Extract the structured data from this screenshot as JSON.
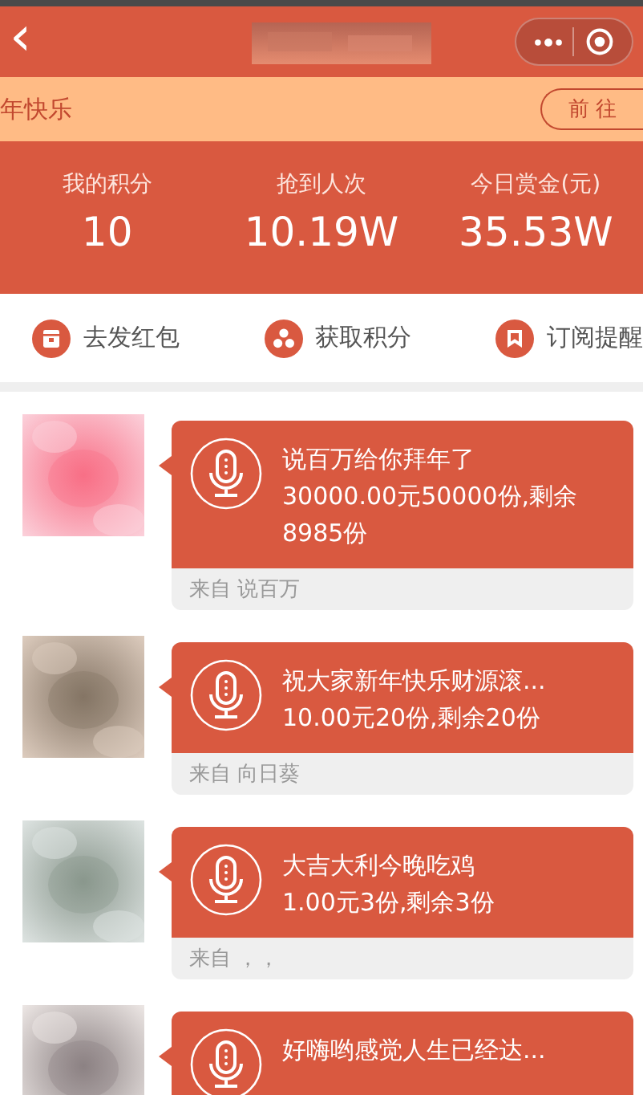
{
  "nav": {
    "back": "‹"
  },
  "banner": {
    "text": "年快乐",
    "button": "前 往"
  },
  "stats": [
    {
      "label": "我的积分",
      "value": "10"
    },
    {
      "label": "抢到人次",
      "value": "10.19W"
    },
    {
      "label": "今日赏金(元)",
      "value": "35.53W"
    }
  ],
  "actions": [
    {
      "kind": "send",
      "label": "去发红包"
    },
    {
      "kind": "points",
      "label": "获取积分"
    },
    {
      "kind": "subscribe",
      "label": "订阅提醒"
    }
  ],
  "posts": [
    {
      "title": "说百万给你拜年了",
      "detail": "30000.00元50000份,剩余8985份",
      "source": "来自 说百万"
    },
    {
      "title": "祝大家新年快乐财源滚...",
      "detail": "10.00元20份,剩余20份",
      "source": "来自 向日葵"
    },
    {
      "title": "大吉大利今晚吃鸡",
      "detail": "1.00元3份,剩余3份",
      "source": "来自 ，，"
    },
    {
      "title": "好嗨哟感觉人生已经达..."
    }
  ]
}
